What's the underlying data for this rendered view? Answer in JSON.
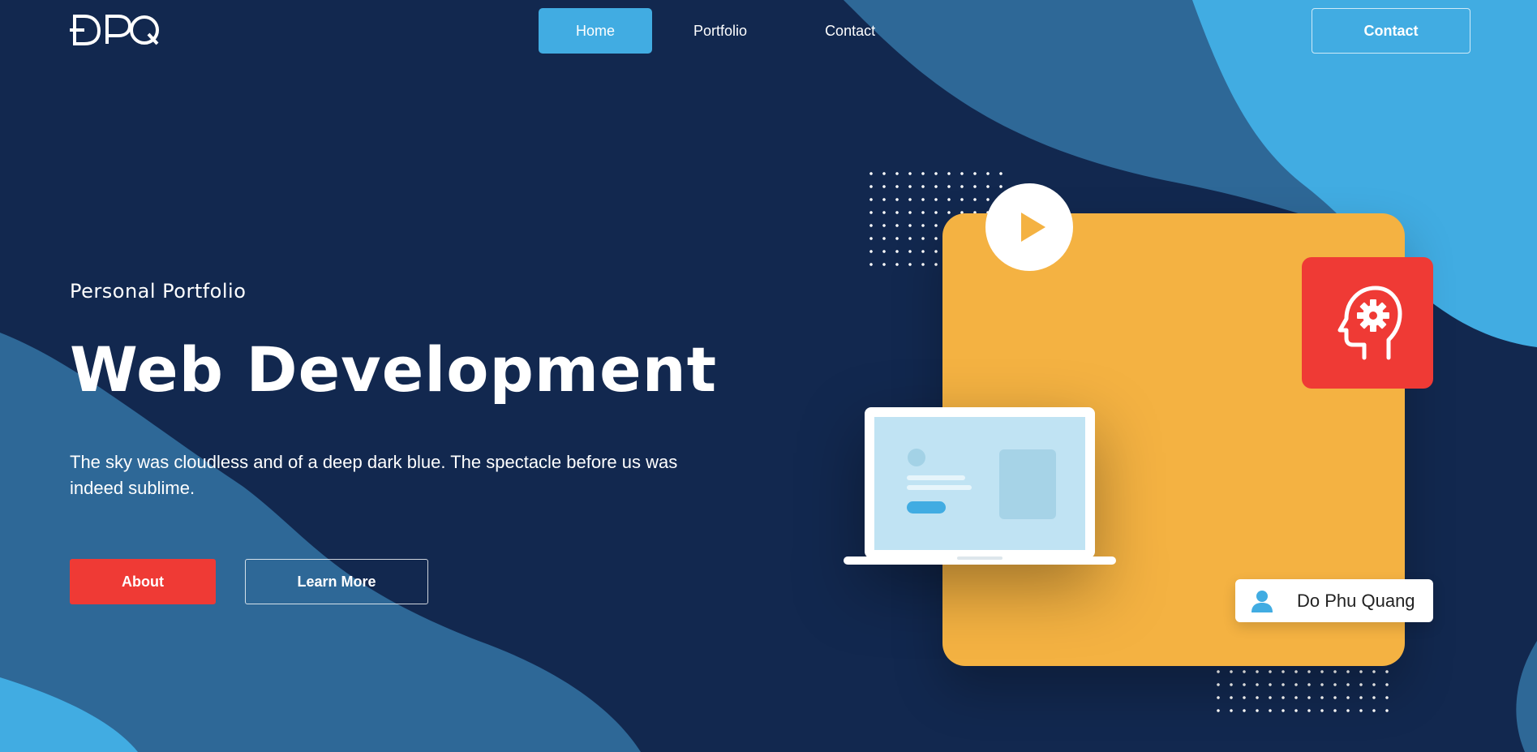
{
  "brand": {
    "logo": "ĐPQ"
  },
  "nav": {
    "items": [
      {
        "label": "Home",
        "active": true
      },
      {
        "label": "Portfolio",
        "active": false
      },
      {
        "label": "Contact",
        "active": false
      }
    ]
  },
  "header": {
    "contact_button": "Contact"
  },
  "hero": {
    "eyebrow": "Personal Portfolio",
    "title": "Web Development",
    "description": "The sky was cloudless and of a deep dark blue. The spectacle before us was indeed sublime.",
    "buttons": {
      "primary": "About",
      "secondary": "Learn More"
    }
  },
  "profile_card": {
    "name": "Do Phu Quang"
  },
  "icons": [
    "play-icon",
    "brain-gear-icon",
    "user-icon",
    "laptop-illustration"
  ],
  "colors": {
    "background": "#12284f",
    "mid_blue": "#2e6897",
    "light_blue": "#41ace2",
    "accent_red": "#ef3a35",
    "accent_yellow": "#f4b242"
  }
}
